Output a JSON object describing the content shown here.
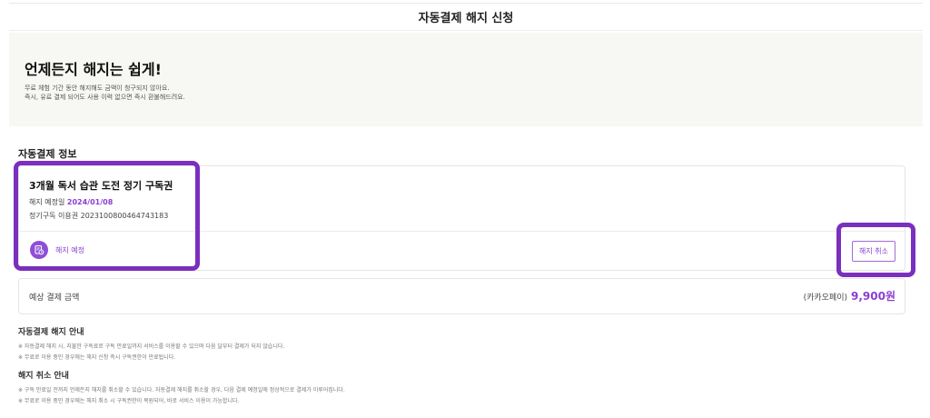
{
  "header": {
    "title": "자동결제 해지 신청"
  },
  "hero": {
    "headline": "언제든지 해지는 쉽게!",
    "desc_line1": "무료 체험 기간 동안 해지해도 금액이 청구되지 않아요.",
    "desc_line2": "즉시, 유료 결제 되어도 사용 이력 없으면 즉시 환불해드려요."
  },
  "autopay_section": {
    "title": "자동결제 정보"
  },
  "subscription": {
    "product_name": "3개월 독서 습관 도전 정기 구독권",
    "cancel_date_label": "해지 예정일",
    "cancel_date": "2024/01/08",
    "voucher_label": "정기구독 이용권",
    "voucher_number": "2023100800464743183",
    "status_label": "해지 예정",
    "cancel_button_label": "해지 취소"
  },
  "payment": {
    "label": "예상 결제 금액",
    "method": "(카카오페이)",
    "amount": "9,900원"
  },
  "notice": {
    "autopay_title": "자동결제 해지 안내",
    "autopay_note1": "※ 자동결제 해지 시, 지불한 구독료로 구독 만료일까지 서비스를 이용할 수 있으며 다음 달부터 결제가 되지 않습니다.",
    "autopay_note2": "※ 무료로 이용 중인 경우에는 해지 신청 즉시 구독권한이 만료됩니다.",
    "revoke_title": "해지 취소 안내",
    "revoke_note1": "※ 구독 만료일 전까지 언제든지 해지를 취소할 수 있습니다. 자동결제 해지를 취소할 경우, 다음 결제 예정일에 정상적으로 결제가 이루어집니다.",
    "revoke_note2": "※ 무료로 이용 중인 경우에는 해지 취소 시 구독권한이 복원되어, 바로 서비스 이용이 가능합니다."
  },
  "colors": {
    "accent": "#8a3fd1",
    "highlight_border": "#7b2fbe",
    "hero_bg": "#f7f7f4"
  },
  "icons": {
    "status": "receipt-clock-icon"
  }
}
